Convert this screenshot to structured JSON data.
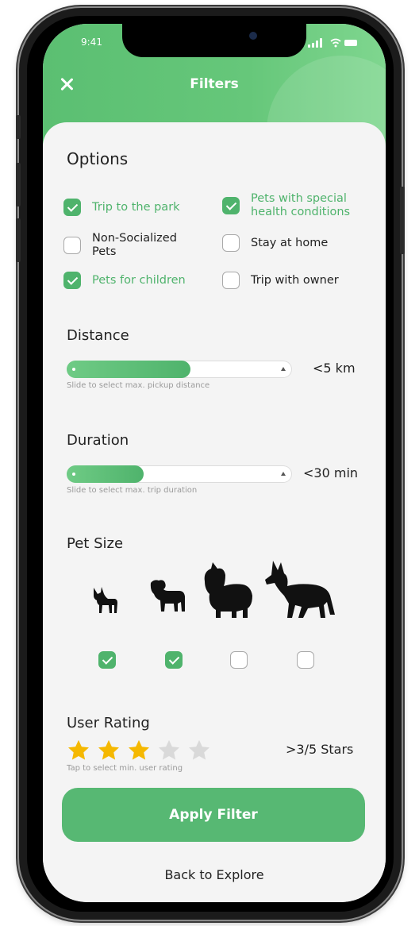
{
  "status": {
    "time": "9:41"
  },
  "header": {
    "title": "Filters"
  },
  "options": {
    "title": "Options",
    "items": [
      {
        "label": "Trip to the park",
        "checked": true
      },
      {
        "label": "Pets with special health conditions",
        "checked": true
      },
      {
        "label": "Non-Socialized Pets",
        "checked": false
      },
      {
        "label": "Stay at home",
        "checked": false
      },
      {
        "label": "Pets for children",
        "checked": true
      },
      {
        "label": "Trip with owner",
        "checked": false
      }
    ]
  },
  "distance": {
    "title": "Distance",
    "value": "<5 km",
    "fill_fraction": 0.55,
    "hint": "Slide to select max. pickup distance"
  },
  "duration": {
    "title": "Duration",
    "value": "<30 min",
    "fill_fraction": 0.34,
    "hint": "Slide to select max. trip duration"
  },
  "pet_size": {
    "title": "Pet Size",
    "sizes": [
      {
        "icon": "chihuahua-icon",
        "checked": true
      },
      {
        "icon": "pug-icon",
        "checked": true
      },
      {
        "icon": "collie-icon",
        "checked": false
      },
      {
        "icon": "german-shepherd-icon",
        "checked": false
      }
    ]
  },
  "user_rating": {
    "title": "User Rating",
    "rating": 3,
    "max": 5,
    "value": ">3/5 Stars",
    "hint": "Tap to select min. user rating"
  },
  "colors": {
    "accent": "#4fb36c",
    "star_on": "#f5b800",
    "star_off": "#d9d9d9"
  },
  "apply_label": "Apply Filter",
  "back_label": "Back to Explore"
}
